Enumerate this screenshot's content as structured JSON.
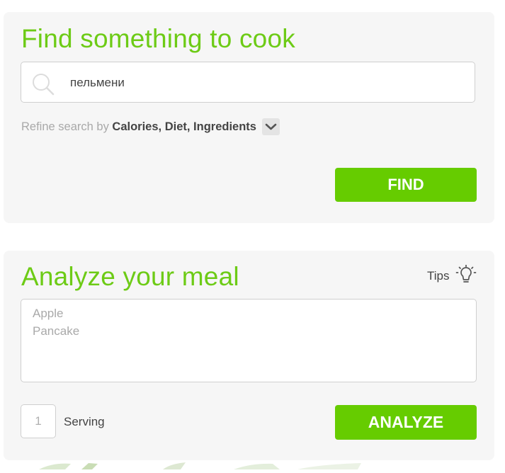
{
  "find": {
    "title": "Find something to cook",
    "search_value": "пельмени",
    "refine_prefix": "Refine search by",
    "refine_options": "Calories, Diet, Ingredients",
    "find_label": "FIND"
  },
  "analyze": {
    "title": "Analyze your meal",
    "tips_label": "Tips",
    "placeholder_lines": [
      "Apple",
      "Pancake"
    ],
    "serving_placeholder": "1",
    "serving_label": "Serving",
    "analyze_label": "ANALYZE"
  },
  "colors": {
    "accent_green": "#6dcb16",
    "button_green": "#66cc00",
    "card_bg": "#f6f6f6"
  },
  "icons": [
    "search-icon",
    "chevron-down-icon",
    "lightbulb-icon"
  ]
}
